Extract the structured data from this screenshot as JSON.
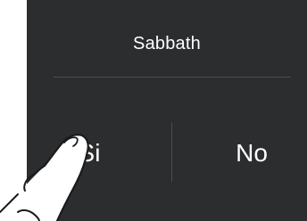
{
  "dialog": {
    "title": "Sabbath",
    "yes_label": "Si",
    "no_label": "No"
  },
  "colors": {
    "panel_background": "#2b2d2f",
    "text": "#ffffff",
    "divider": "#4a4c4f"
  },
  "icons": {
    "pointer": "hand-pointer-icon"
  }
}
